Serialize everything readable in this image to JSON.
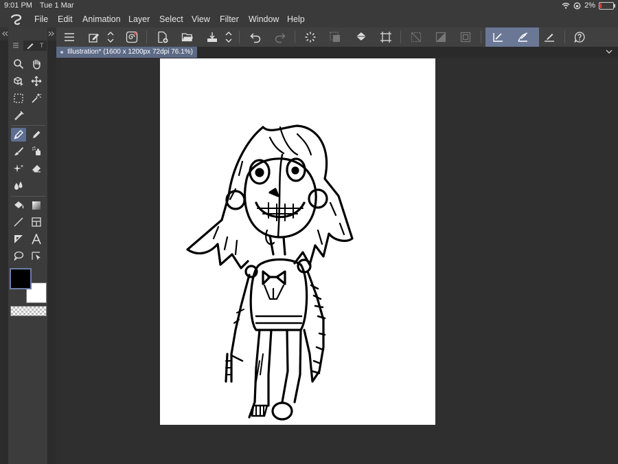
{
  "status": {
    "time": "9:01 PM",
    "date": "Tue 1 Mar",
    "battery": "2%"
  },
  "menu": [
    "File",
    "Edit",
    "Animation",
    "Layer",
    "Select",
    "View",
    "Filter",
    "Window",
    "Help"
  ],
  "left_panel": {
    "tab_label": "T"
  },
  "document_tab": {
    "label": "Illustration* (1600 x 1200px 72dpi 76.1%)"
  },
  "colors": {
    "main": "#000000",
    "sub": "#ffffff",
    "accent": "#5f6f92"
  }
}
